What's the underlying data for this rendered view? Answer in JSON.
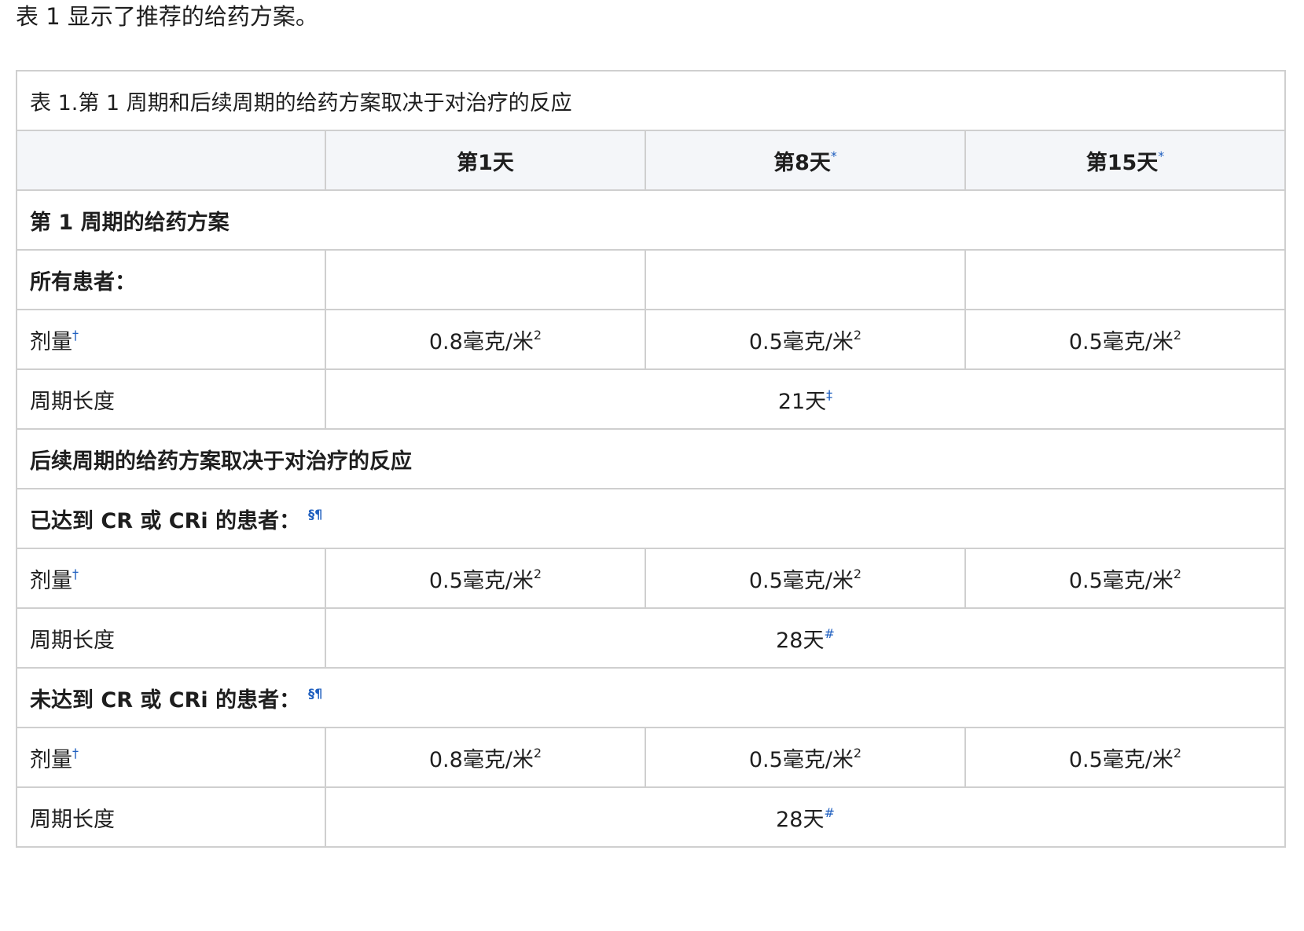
{
  "intro": "表 1 显示了推荐的给药方案。",
  "table": {
    "caption": "表 1.第 1 周期和后续周期的给药方案取决于对治疗的反应",
    "header": {
      "blank": "",
      "day1": "第1天",
      "day8": "第8天",
      "day8_mark": "*",
      "day15": "第15天",
      "day15_mark": "*"
    },
    "section1": {
      "title": "第 1 周期的给药方案",
      "group": "所有患者：",
      "dose_label": "剂量",
      "dose_mark": "†",
      "doses": [
        "0.8毫克/米",
        "0.5毫克/米",
        "0.5毫克/米"
      ],
      "dose_exp": "2",
      "cycle_label": "周期长度",
      "cycle_value": "21天",
      "cycle_mark": "‡"
    },
    "section2": {
      "title": "后续周期的给药方案取决于对治疗的反应",
      "groupA": {
        "label": "已达到 CR 或 CRi 的患者：",
        "mark": "§¶",
        "dose_label": "剂量",
        "dose_mark": "†",
        "doses": [
          "0.5毫克/米",
          "0.5毫克/米",
          "0.5毫克/米"
        ],
        "dose_exp": "2",
        "cycle_label": "周期长度",
        "cycle_value": "28天",
        "cycle_mark": "#"
      },
      "groupB": {
        "label": "未达到 CR 或 CRi 的患者：",
        "mark": "§¶",
        "dose_label": "剂量",
        "dose_mark": "†",
        "doses": [
          "0.8毫克/米",
          "0.5毫克/米",
          "0.5毫克/米"
        ],
        "dose_exp": "2",
        "cycle_label": "周期长度",
        "cycle_value": "28天",
        "cycle_mark": "#"
      }
    }
  }
}
